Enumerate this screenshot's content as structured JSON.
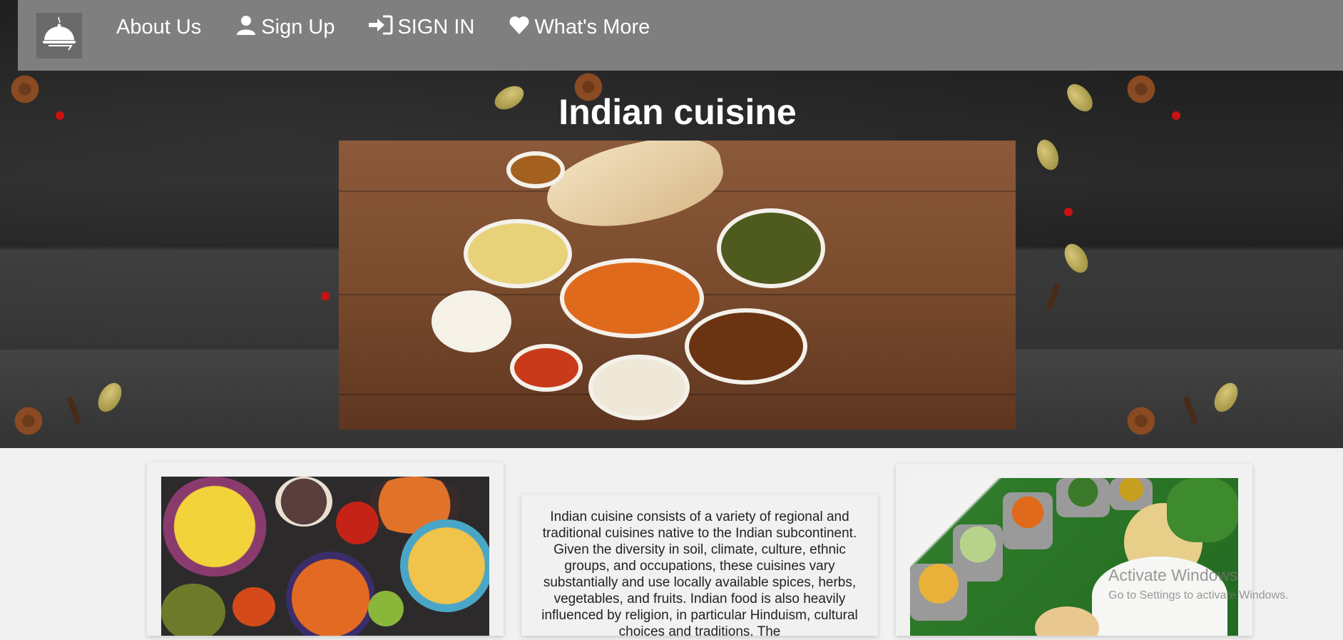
{
  "nav": {
    "logo_icon": "cloche-icon",
    "items": [
      {
        "label": "About Us",
        "icon": ""
      },
      {
        "label": "Sign Up",
        "icon": "user-icon"
      },
      {
        "label": "SIGN IN",
        "icon": "sign-in-icon"
      },
      {
        "label": "What's More",
        "icon": "heart-icon"
      }
    ]
  },
  "hero": {
    "title": "Indian cuisine"
  },
  "main": {
    "description": "Indian cuisine consists of a variety of regional and traditional cuisines native to the Indian subcontinent. Given the diversity in soil, climate, culture, ethnic groups, and occupations, these cuisines vary substantially and use locally available spices, herbs, vegetables, and fruits. Indian food is also heavily influenced by religion, in particular Hinduism, cultural choices and traditions. The"
  },
  "watermark": {
    "line1": "Activate Windows",
    "line2": "Go to Settings to activate Windows."
  },
  "colors": {
    "navbar": "#7f7f7f",
    "page_bg": "#f1f1f1",
    "hero_bg": "#222222"
  }
}
